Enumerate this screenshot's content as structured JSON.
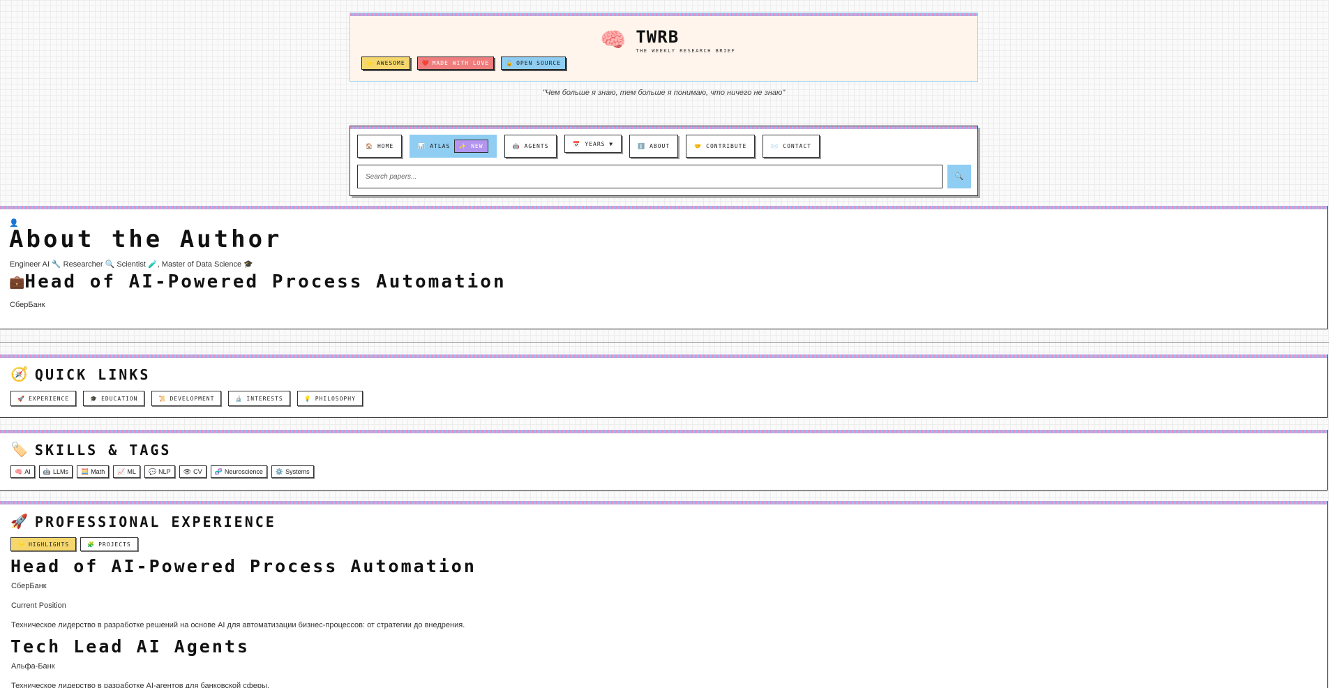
{
  "header": {
    "title": "TWRB",
    "subtitle": "THE WEEKLY RESEARCH BRIEF",
    "logo_icon": "🧠",
    "badges": [
      {
        "icon": "⭐",
        "label": "AWESOME"
      },
      {
        "icon": "❤️",
        "label": "MADE WITH LOVE"
      },
      {
        "icon": "🔓",
        "label": "OPEN SOURCE"
      }
    ]
  },
  "quote": "\"Чем больше я знаю, тем больше я понимаю, что ничего не знаю\"",
  "nav": {
    "items": [
      {
        "icon": "🏠",
        "label": "HOME"
      },
      {
        "icon": "📊",
        "label": "ATLAS",
        "badge": "✨ NEW"
      },
      {
        "icon": "🤖",
        "label": "AGENTS"
      },
      {
        "icon": "📅",
        "label": "YEARS ▼"
      },
      {
        "icon": "ℹ️",
        "label": "ABOUT"
      },
      {
        "icon": "🤝",
        "label": "CONTRIBUTE"
      },
      {
        "icon": "✉️",
        "label": "CONTACT"
      }
    ],
    "search_placeholder": "Search papers...",
    "search_icon": "🔍"
  },
  "about": {
    "icon": "👤",
    "title": "About the Author",
    "tagline": "Engineer AI 🔧 Researcher 🔍 Scientist 🧪, Master of Data Science 🎓",
    "role_icon": "💼",
    "role": "Head of AI-Powered Process Automation",
    "company": "СберБанк"
  },
  "quick_links": {
    "icon": "🧭",
    "title": "QUICK LINKS",
    "items": [
      {
        "icon": "🚀",
        "label": "EXPERIENCE"
      },
      {
        "icon": "🎓",
        "label": "EDUCATION"
      },
      {
        "icon": "📜",
        "label": "DEVELOPMENT"
      },
      {
        "icon": "🔬",
        "label": "INTERESTS"
      },
      {
        "icon": "💡",
        "label": "PHILOSOPHY"
      }
    ]
  },
  "skills": {
    "icon": "🏷️",
    "title": "SKILLS & TAGS",
    "tags": [
      {
        "icon": "🧠",
        "label": "AI"
      },
      {
        "icon": "🤖",
        "label": "LLMs"
      },
      {
        "icon": "🧮",
        "label": "Math"
      },
      {
        "icon": "📈",
        "label": "ML"
      },
      {
        "icon": "💬",
        "label": "NLP"
      },
      {
        "icon": "👁",
        "label": "CV"
      },
      {
        "icon": "🧬",
        "label": "Neuroscience"
      },
      {
        "icon": "⚙️",
        "label": "Systems"
      }
    ]
  },
  "experience": {
    "icon": "🚀",
    "title": "PROFESSIONAL EXPERIENCE",
    "tabs": [
      {
        "icon": "⭐",
        "label": "HIGHLIGHTS"
      },
      {
        "icon": "🧩",
        "label": "PROJECTS"
      }
    ],
    "jobs": [
      {
        "title": "Head of AI-Powered Process Automation",
        "company": "СберБанк",
        "status": "Current Position",
        "description": "Техническое лидерство в разработке решений на основе AI для автоматизации бизнес-процессов: от стратегии до внедрения."
      },
      {
        "title": "Tech Lead AI Agents",
        "company": "Альфа-Банк",
        "description": "Техническое лидерство в разработке AI-агентов для банковской сферы."
      }
    ]
  },
  "colors": {
    "header_bg": "#fff5ec",
    "accent_blue": "#8fcdf2",
    "accent_yellow": "#f5d76e",
    "accent_red": "#ef7d7d",
    "accent_purple": "#b395ef",
    "stripe_pink": "#e591c6",
    "stripe_blue": "#9fb9f0"
  }
}
